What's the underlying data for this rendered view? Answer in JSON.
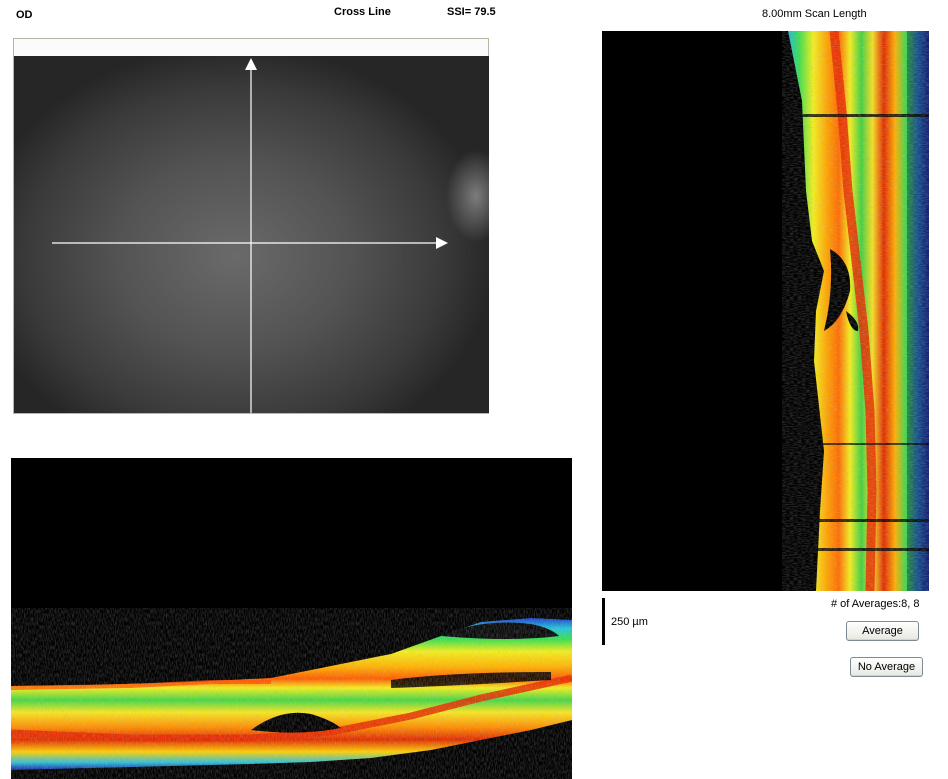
{
  "header": {
    "eye": "OD",
    "scan_type": "Cross Line",
    "ssi": "SSI= 79.5",
    "scan_length": "8.00mm Scan Length"
  },
  "fundus": {
    "crosshair_icon": "crosshair-arrows-icon"
  },
  "scale_bar": {
    "label": "250 µm"
  },
  "averages": {
    "label": "# of Averages:8, 8",
    "average_button": "Average",
    "no_average_button": "No Average"
  }
}
